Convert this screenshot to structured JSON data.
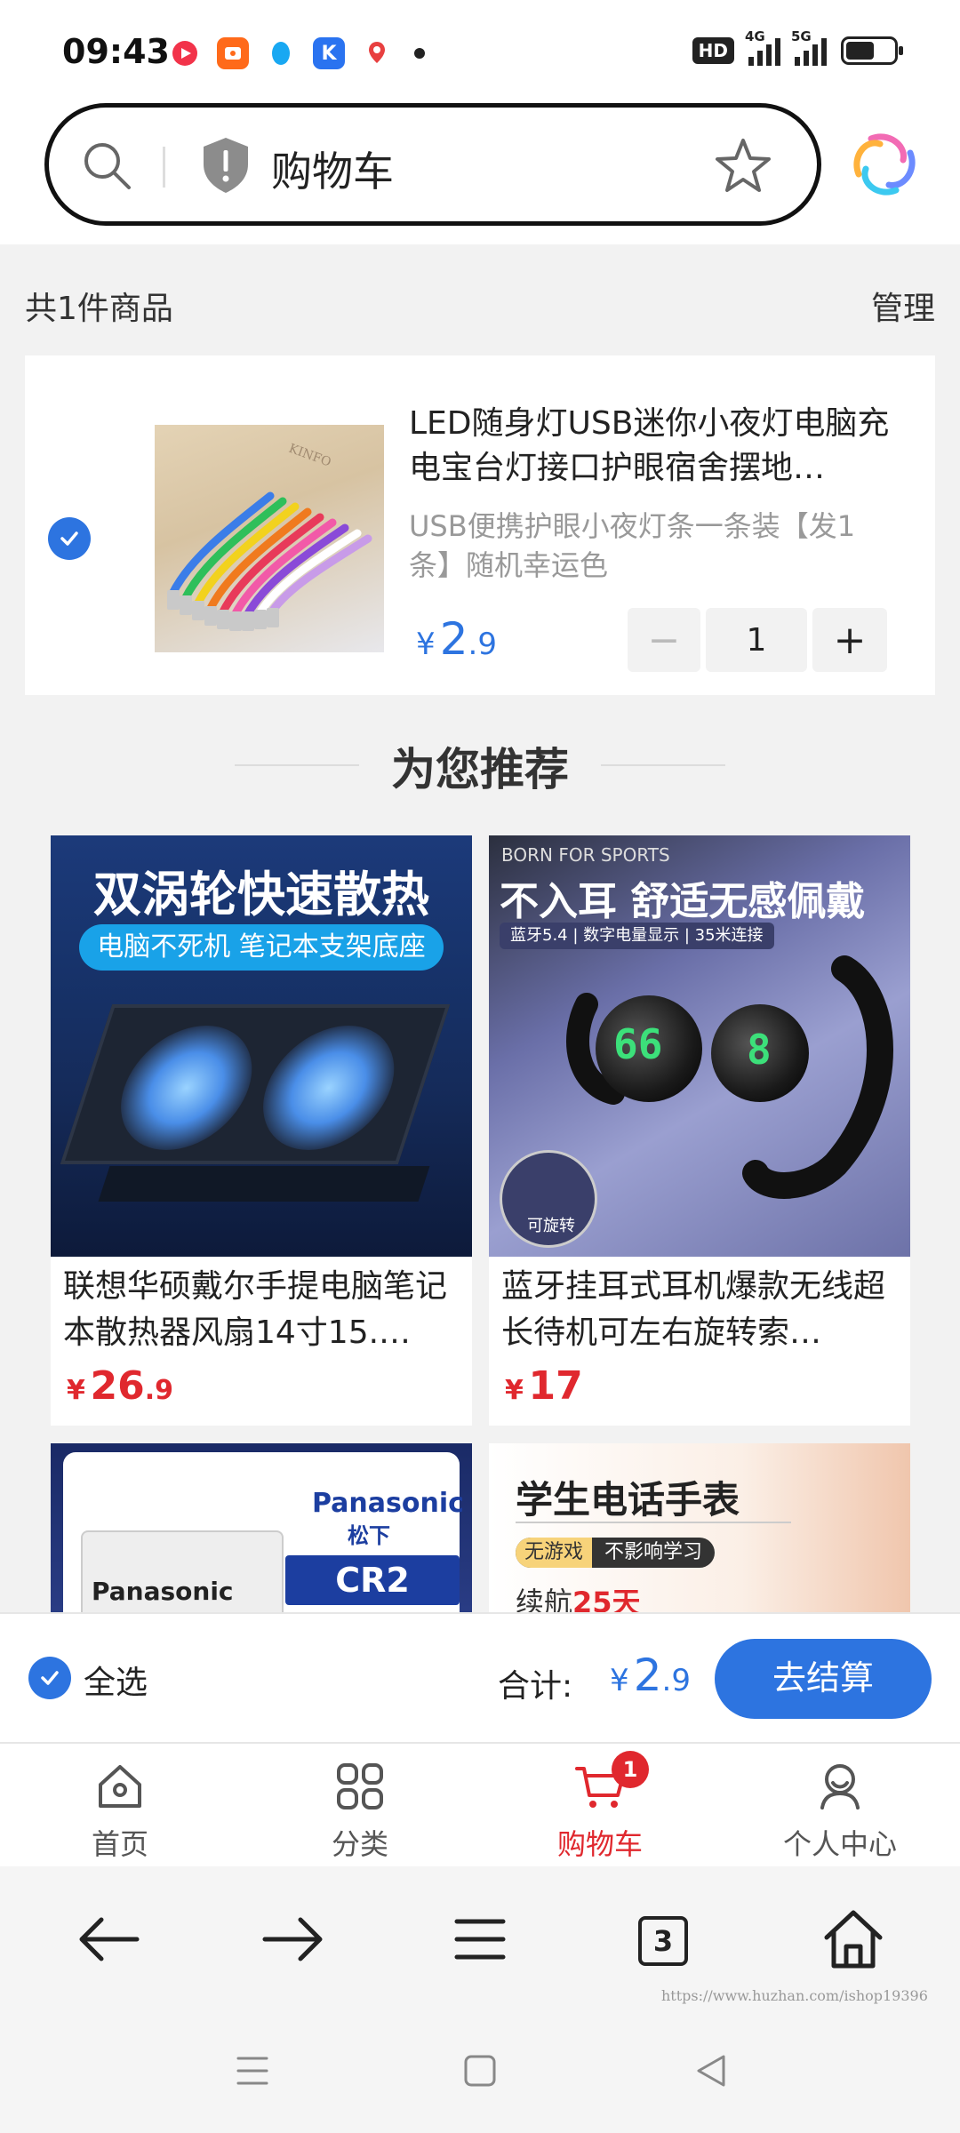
{
  "status_bar": {
    "time": "09:43",
    "hd_label": "HD",
    "signal1_label": "4G",
    "signal2_label": "5G",
    "app_icons": [
      "video-app-icon",
      "taobao-app-icon",
      "qq-app-icon",
      "k-app-icon",
      "map-app-icon"
    ]
  },
  "search": {
    "text": "购物车"
  },
  "cart": {
    "count_label": "共1件商品",
    "manage_label": "管理",
    "item": {
      "title": "LED随身灯USB迷你小夜灯电脑充电宝台灯接口护眼宿舍摆地…",
      "spec": "USB便携护眼小夜灯条一条装【发1条】随机幸运色",
      "price_currency": "¥",
      "price_int": "2",
      "price_dec": ".9",
      "quantity": "1",
      "minus_label": "−",
      "plus_label": "+",
      "image_brand": "KINFO"
    }
  },
  "recommend": {
    "title": "为您推荐",
    "products": [
      {
        "title": "联想华硕戴尔手提电脑笔记本散热器风扇14寸15.…",
        "price_currency": "¥",
        "price_int": "26",
        "price_dec": ".9",
        "image_headline": "双涡轮快速散热",
        "image_subline": "电脑不死机 笔记本支架底座"
      },
      {
        "title": "蓝牙挂耳式耳机爆款无线超长待机可左右旋转索…",
        "price_currency": "¥",
        "price_int": "17",
        "price_dec": "",
        "image_brand": "BORN FOR SPORTS",
        "image_headline": "不入耳 舒适无感佩戴",
        "image_subline": "蓝牙5.4 | 数字电量显示 | 35米连接",
        "image_digit_left": "66",
        "image_digit_right": "8",
        "image_rotate_label": "可旋转"
      },
      {
        "image_card_brand": "Panasonic",
        "image_logo": "Panasonic",
        "image_logo_cn": "松下",
        "image_model": "CR2"
      },
      {
        "image_headline": "学生电话手表",
        "image_tag_a": "无游戏",
        "image_tag_b": "不影响学习",
        "image_battery_text": "续航",
        "image_battery_num": "25天"
      }
    ]
  },
  "checkout": {
    "select_all_label": "全选",
    "total_label": "合计:",
    "total_currency": "¥",
    "total_int": "2",
    "total_dec": ".9",
    "checkout_label": "去结算"
  },
  "tabs": [
    {
      "label": "首页",
      "icon": "home-icon"
    },
    {
      "label": "分类",
      "icon": "category-icon"
    },
    {
      "label": "购物车",
      "icon": "cart-icon",
      "badge": "1",
      "active": true
    },
    {
      "label": "个人中心",
      "icon": "profile-icon"
    }
  ],
  "browser_nav": {
    "tabs_count": "3"
  },
  "watermark": "https://www.huzhan.com/ishop19396",
  "colors": {
    "accent_blue": "#2d74e0",
    "price_red": "#e0282e"
  }
}
